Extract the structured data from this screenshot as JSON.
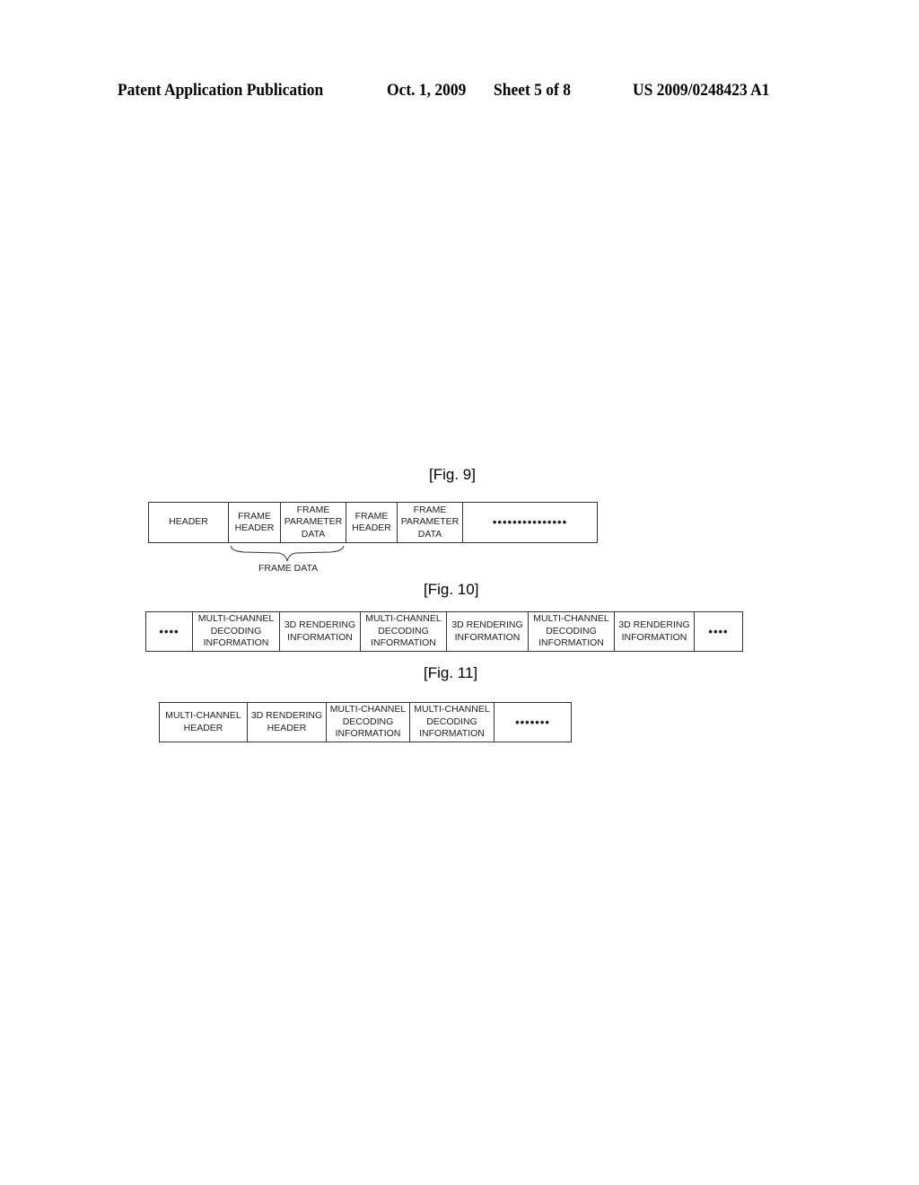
{
  "header": {
    "publication": "Patent Application Publication",
    "date": "Oct. 1, 2009",
    "sheet": "Sheet 5 of 8",
    "number": "US 2009/0248423 A1"
  },
  "fig9": {
    "label": "[Fig. 9]",
    "cells": [
      "HEADER",
      "FRAME\nHEADER",
      "FRAME\nPARAMETER\nDATA",
      "FRAME\nHEADER",
      "FRAME\nPARAMETER\nDATA",
      "•••••••••••••••"
    ],
    "brace_label": "FRAME DATA"
  },
  "fig10": {
    "label": "[Fig. 10]",
    "cells": [
      "••••",
      "MULTI-CHANNEL\nDECODING\nINFORMATION",
      "3D RENDERING\nINFORMATION",
      "MULTI-CHANNEL\nDECODING\nINFORMATION",
      "3D RENDERING\nINFORMATION",
      "MULTI-CHANNEL\nDECODING\nINFORMATION",
      "3D RENDERING\nINFORMATION",
      "••••"
    ]
  },
  "fig11": {
    "label": "[Fig. 11]",
    "cells": [
      "MULTI-CHANNEL\nHEADER",
      "3D RENDERING\nHEADER",
      "MULTI-CHANNEL\nDECODING\nINFORMATION",
      "MULTI-CHANNEL\nDECODING\nINFORMATION",
      "•••••••"
    ]
  }
}
